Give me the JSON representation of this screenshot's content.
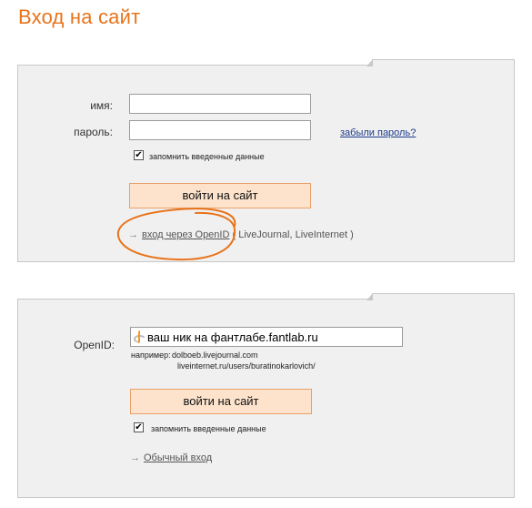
{
  "page": {
    "title": "Вход на сайт"
  },
  "login_form": {
    "name_label": "имя:",
    "name_value": "",
    "password_label": "пароль:",
    "password_value": "",
    "forgot_password": "забыли пароль?",
    "remember_label": "запомнить введенные данные",
    "remember_checked": true,
    "submit_label": "войти на сайт",
    "openid_arrow": "→",
    "openid_link": "вход через OpenID",
    "openid_providers": "( LiveJournal, LiveInternet )"
  },
  "openid_form": {
    "openid_label": "OpenID:",
    "openid_value": "ваш ник на фантлабе.fantlab.ru",
    "example_label": "например:",
    "example_1": "dolboeb.livejournal.com",
    "example_2": "liveinternet.ru/users/buratinokarlovich/",
    "submit_label": "войти на сайт",
    "remember_label": "запомнить введенные данные",
    "remember_checked": true,
    "normal_arrow": "→",
    "normal_login_link": "Обычный вход"
  },
  "colors": {
    "title": "#e8731a",
    "button_bg": "#fde3cc",
    "button_border": "#e9a06a",
    "panel_bg": "#f0f0f0",
    "highlight_circle": "#e8731a",
    "openid_logo": "#f7941e"
  }
}
